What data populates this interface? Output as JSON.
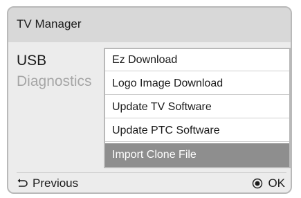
{
  "window": {
    "title": "TV Manager"
  },
  "left_menu": {
    "items": [
      {
        "label": "USB",
        "state": "active"
      },
      {
        "label": "Diagnostics",
        "state": "inactive"
      }
    ]
  },
  "submenu": {
    "items": [
      {
        "label": "Ez Download"
      },
      {
        "label": "Logo Image Download"
      },
      {
        "label": "Update TV Software"
      },
      {
        "label": "Update PTC Software"
      },
      {
        "label": "Import Clone File"
      }
    ],
    "selected_label": "Import Clone File"
  },
  "footer": {
    "previous_label": "Previous",
    "previous_icon": "return-arrow-icon",
    "ok_label": "OK",
    "ok_icon": "ok-dot-icon"
  },
  "colors": {
    "frame_background": "#ececec",
    "title_bar": "#d8d8d8",
    "border": "#b9b9b9",
    "selected_highlight": "#8e8e8e",
    "inactive_text": "#a6a6a6"
  }
}
